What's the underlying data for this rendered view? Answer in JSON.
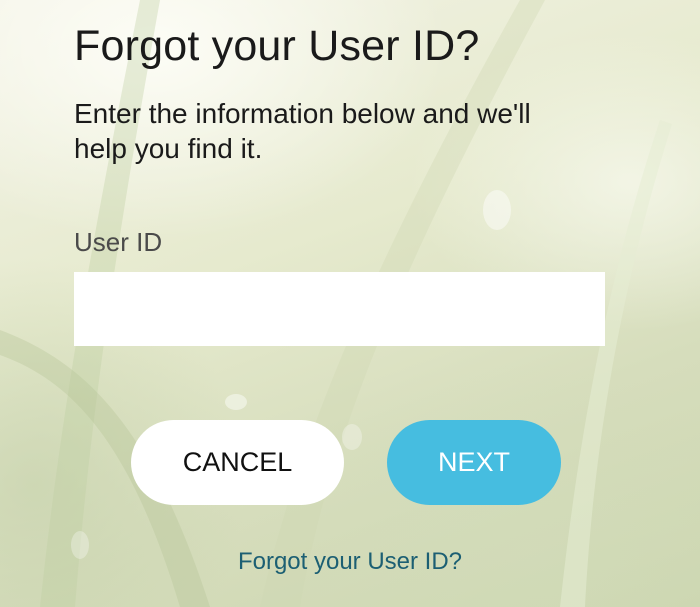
{
  "page": {
    "title": "Forgot your User ID?",
    "subtitle": "Enter the information below and we'll help you find it."
  },
  "form": {
    "userid_label": "User ID",
    "userid_value": "",
    "userid_placeholder": ""
  },
  "actions": {
    "cancel_label": "CANCEL",
    "next_label": "NEXT"
  },
  "footer": {
    "forgot_link": "Forgot your User ID?"
  },
  "colors": {
    "primary_button": "#46bde0",
    "link": "#1c5f73",
    "background_tint": "#dfe5c8"
  }
}
